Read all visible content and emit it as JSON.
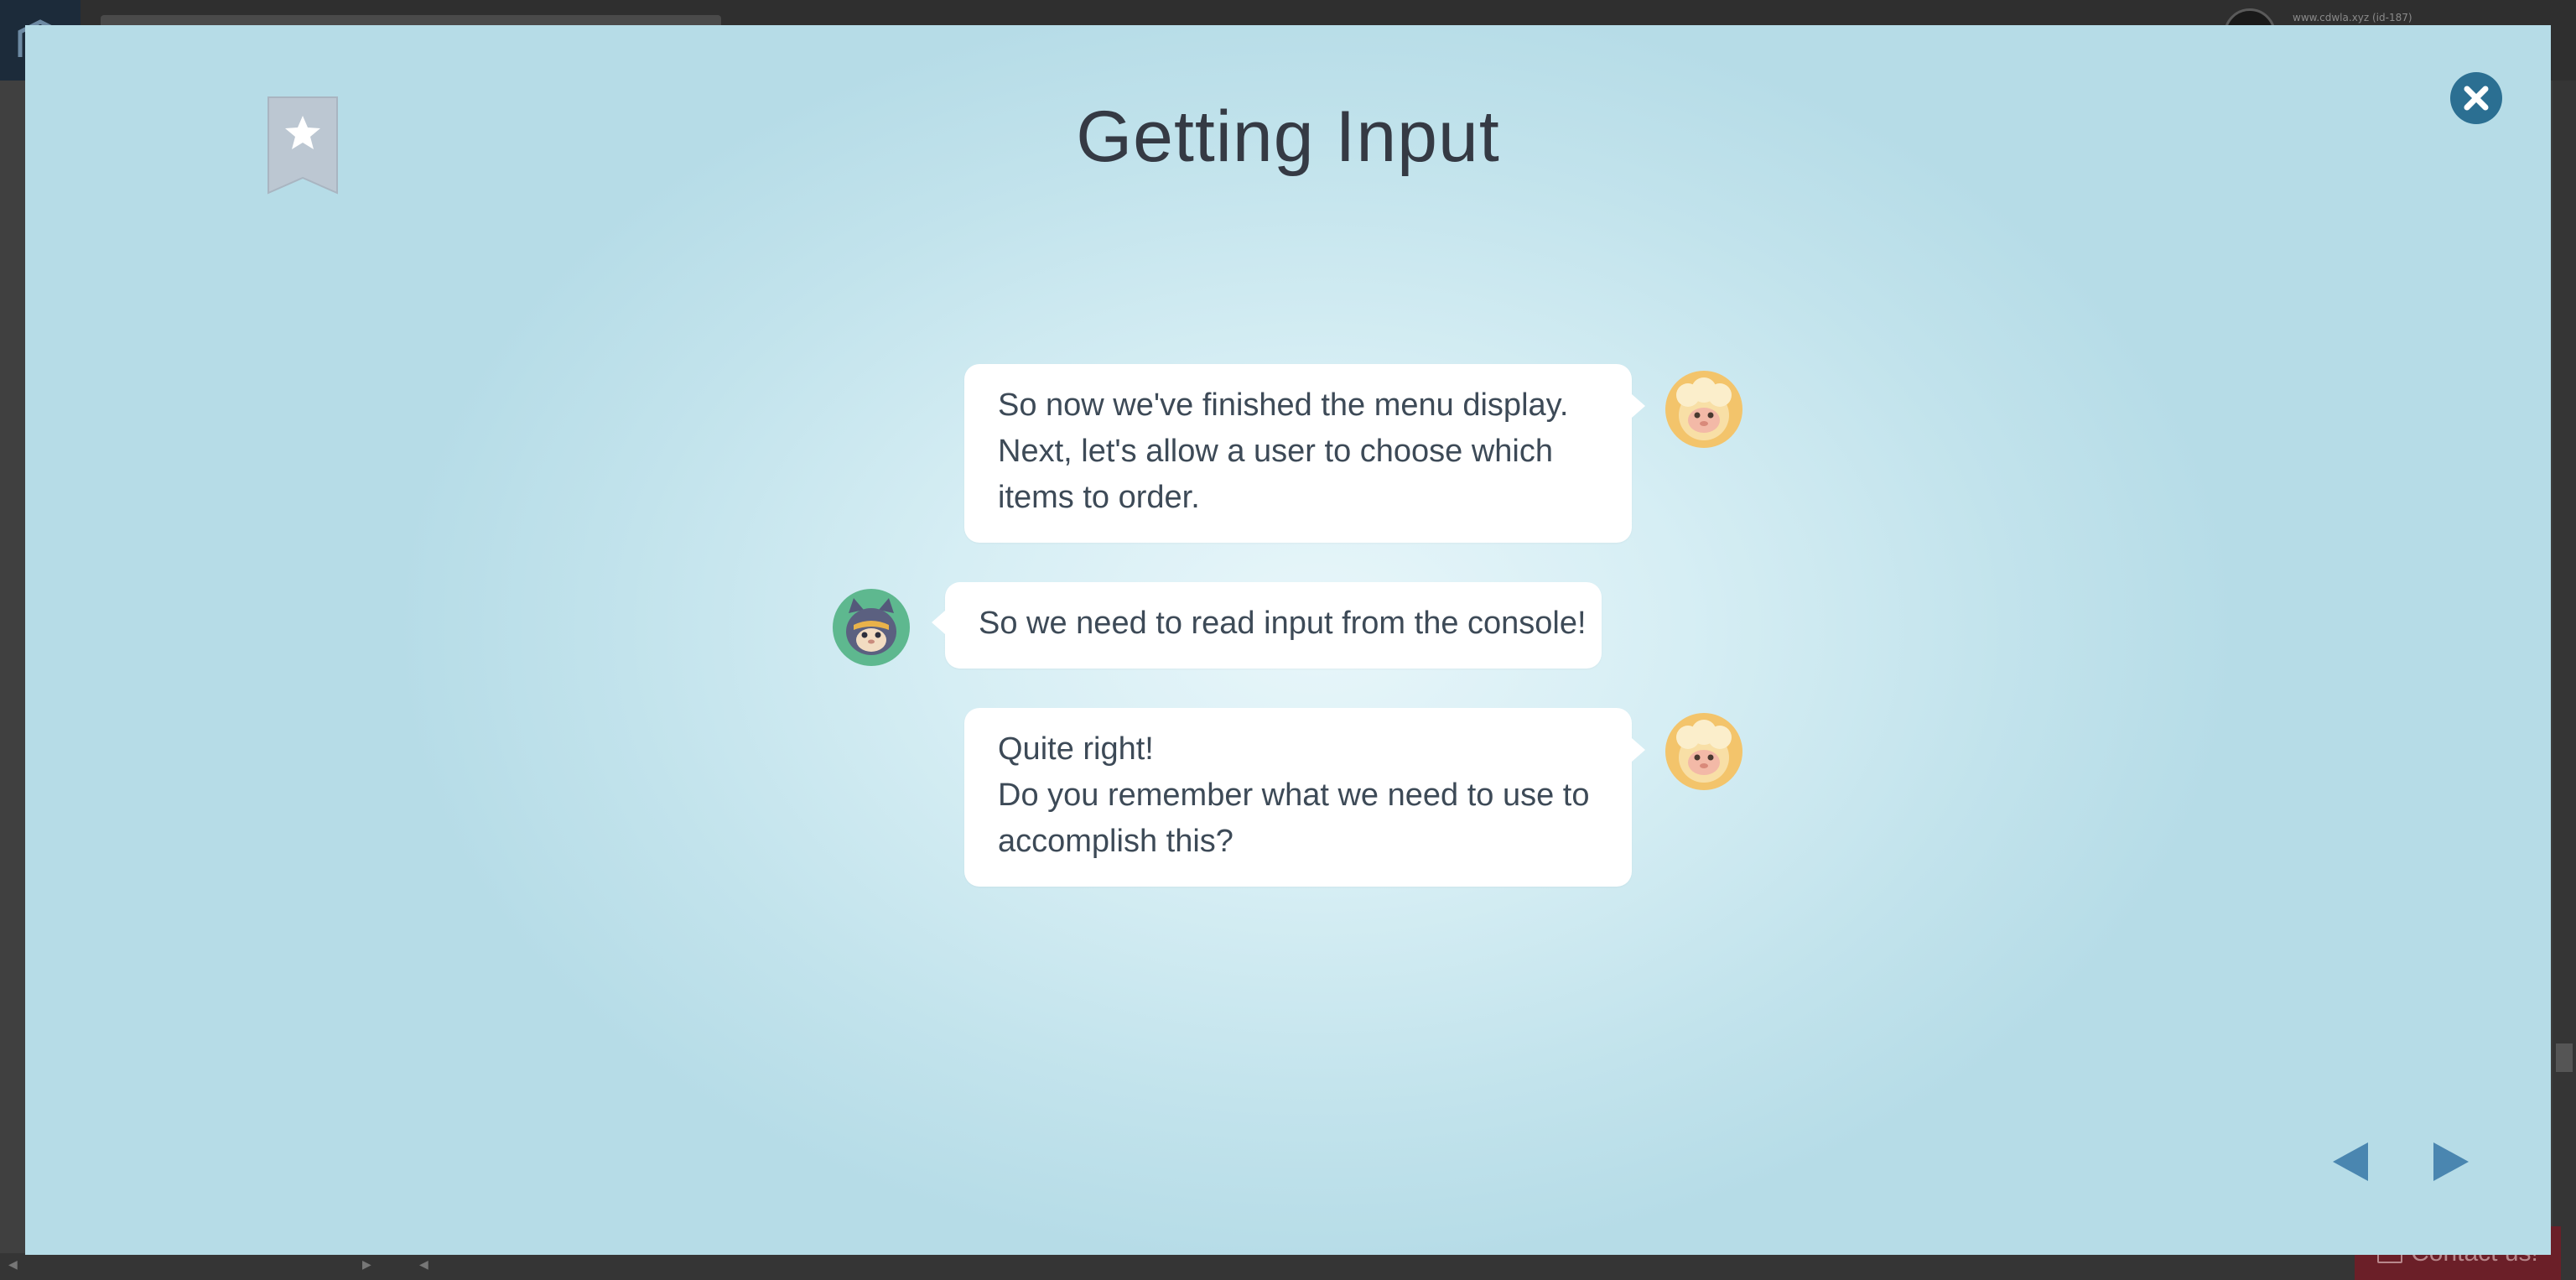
{
  "background": {
    "user_label": "www.cdwla.xyz (id-187)",
    "contact_label": "Contact us!"
  },
  "modal": {
    "title": "Getting Input",
    "bookmark_icon": "star-bookmark-icon",
    "close_icon": "close-icon",
    "messages": [
      {
        "speaker": "sheep",
        "side": "right",
        "lines": [
          "So now we've finished the menu display.",
          "Next, let's allow a user to choose which",
          "items to order."
        ]
      },
      {
        "speaker": "cat",
        "side": "left",
        "lines": [
          "So we need to read input from the console!"
        ]
      },
      {
        "speaker": "sheep",
        "side": "right",
        "lines": [
          "Quite right!",
          "Do you remember what we need to use to",
          "accomplish this?"
        ]
      }
    ],
    "nav": {
      "prev_icon": "triangle-left-icon",
      "next_icon": "triangle-right-icon"
    }
  },
  "colors": {
    "modal_bg": "#c2e3ec",
    "close_button": "#2b6f92",
    "nav_arrow": "#4a86b0",
    "bubble_text": "#3d4a57",
    "title_text": "#353a44"
  }
}
